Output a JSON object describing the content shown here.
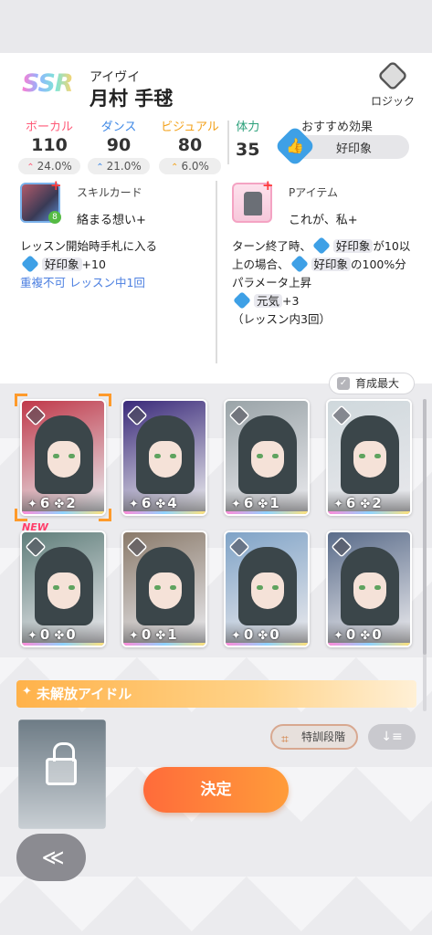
{
  "rarity": "SSR",
  "idol": {
    "kana": "アイヴイ",
    "name": "月村 手毬"
  },
  "logic": {
    "label": "ロジック",
    "icon": "logic-diamond-icon"
  },
  "stats": [
    {
      "label": "ボーカル",
      "value": "110",
      "pct": "24.0%",
      "color": "#ff5a78"
    },
    {
      "label": "ダンス",
      "value": "90",
      "pct": "21.0%",
      "color": "#3e88e6"
    },
    {
      "label": "ビジュアル",
      "value": "80",
      "pct": "6.0%",
      "color": "#f3a21c"
    }
  ],
  "stamina": {
    "label": "体力",
    "value": "35",
    "color": "#2aa07a"
  },
  "recommended": {
    "label": "おすすめ効果",
    "value": "好印象"
  },
  "skill_card": {
    "title": "スキルカード",
    "name": "絡まる想い+",
    "level": "8",
    "desc_line1": "レッスン開始時手札に入る",
    "effect": "好印象",
    "effect_suffix": "+10",
    "note": "重複不可 レッスン中1回"
  },
  "p_item": {
    "title": "Pアイテム",
    "name": "これが、私+",
    "line1": "ターン終了時、",
    "chip1": "好印象",
    "line1_suffix": "が10以",
    "line2": "上の場合、",
    "chip2": "好印象",
    "line2_suffix": "の100%分",
    "line3": "パラメータ上昇",
    "chip3": "元気",
    "chip3_suffix": "+3",
    "line4": "（レッスン内3回）"
  },
  "grow_max": {
    "label": "育成最大",
    "checked": true
  },
  "cards": [
    {
      "stars": "6",
      "clovers": "2",
      "bg": "#c0394a",
      "new": false,
      "selected": true
    },
    {
      "stars": "6",
      "clovers": "4",
      "bg": "#3a2a7a",
      "new": false,
      "selected": false
    },
    {
      "stars": "6",
      "clovers": "1",
      "bg": "#9aa4a8",
      "new": false,
      "selected": false
    },
    {
      "stars": "6",
      "clovers": "2",
      "bg": "#cfd8dc",
      "new": false,
      "selected": false
    },
    {
      "stars": "0",
      "clovers": "0",
      "bg": "#5f7e7a",
      "new": true,
      "selected": false
    },
    {
      "stars": "0",
      "clovers": "1",
      "bg": "#8a7a6a",
      "new": false,
      "selected": false
    },
    {
      "stars": "0",
      "clovers": "0",
      "bg": "#7fa3c7",
      "new": false,
      "selected": false
    },
    {
      "stars": "0",
      "clovers": "0",
      "bg": "#5a6c8a",
      "new": false,
      "selected": false
    }
  ],
  "new_label": "NEW",
  "unreleased": {
    "title": "未解放アイドル"
  },
  "sort": {
    "label": "特訓段階"
  },
  "decide": {
    "label": "決定"
  },
  "back": {
    "label": "≪"
  }
}
